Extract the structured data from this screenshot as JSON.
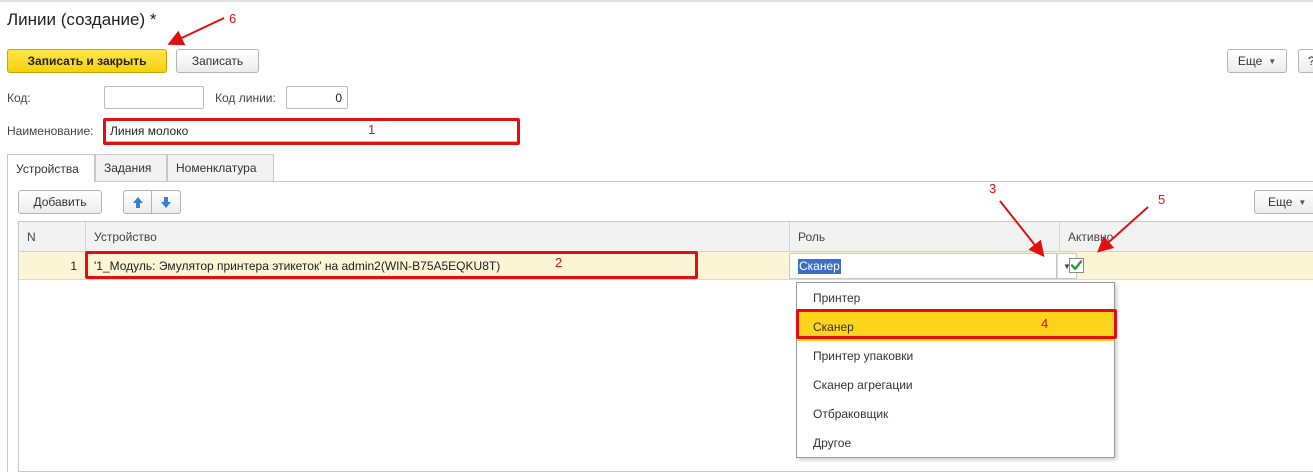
{
  "window": {
    "title": "Линии (создание) *"
  },
  "toolbar": {
    "save_close_label": "Записать и закрыть",
    "save_label": "Записать",
    "more_label": "Еще",
    "help_label": "?"
  },
  "form": {
    "code_label": "Код:",
    "code_value": "",
    "line_code_label": "Код линии:",
    "line_code_value": "0",
    "name_label": "Наименование:",
    "name_value": "Линия молоко"
  },
  "tabs": [
    {
      "label": "Устройства",
      "active": true
    },
    {
      "label": "Задания",
      "active": false
    },
    {
      "label": "Номенклатура",
      "active": false
    }
  ],
  "table_toolbar": {
    "add_label": "Добавить",
    "more_label": "Еще"
  },
  "table": {
    "columns": [
      "N",
      "Устройство",
      "Роль",
      "Активно"
    ],
    "rows": [
      {
        "n": "1",
        "device": "'1_Модуль: Эмулятор принтера этикеток' на admin2(WIN-B75A5EQKU8T)",
        "role": "Сканер",
        "active": true
      }
    ]
  },
  "role_options": {
    "items": [
      "Принтер",
      "Сканер",
      "Принтер упаковки",
      "Сканер агрегации",
      "Отбраковщик",
      "Другое"
    ],
    "selected": "Сканер"
  },
  "annotations": [
    "1",
    "2",
    "3",
    "4",
    "5",
    "6"
  ],
  "colors": {
    "primary_button": "#f5d00b",
    "selected_row": "#fbf4d5",
    "highlight_option": "#fdd31c",
    "annotation": "#e01010",
    "checkbox": "#2a9d3a",
    "arrow_icon": "#3a7fd0"
  }
}
